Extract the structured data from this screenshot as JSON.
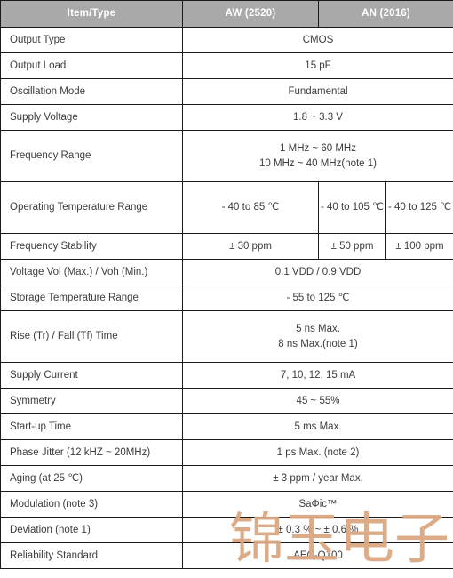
{
  "table": {
    "headers": [
      {
        "label": "Item/Type"
      },
      {
        "label": "AW (2520)"
      },
      {
        "label": "AN (2016)"
      }
    ],
    "rows": [
      {
        "name": "output-type",
        "label": "Output Type",
        "span": "full",
        "value": "CMOS"
      },
      {
        "name": "output-load",
        "label": "Output Load",
        "span": "full",
        "value": "15 pF"
      },
      {
        "name": "oscillation-mode",
        "label": "Oscillation Mode",
        "span": "full",
        "value": "Fundamental"
      },
      {
        "name": "supply-voltage",
        "label": "Supply Voltage",
        "span": "full",
        "value": "1.8 ~ 3.3 V"
      },
      {
        "name": "frequency-range",
        "label": "Frequency Range",
        "span": "full",
        "tall": true,
        "line1": "1 MHz ~ 60 MHz",
        "line2": "10 MHz ~ 40 MHz(note 1)"
      },
      {
        "name": "operating-temperature-range",
        "label": "Operating Temperature Range",
        "span": "split",
        "tall": true,
        "aw": "- 40 to 85 ℃",
        "an1": "- 40 to 105 ℃",
        "an2": "- 40 to 125 ℃"
      },
      {
        "name": "frequency-stability",
        "label": "Frequency Stability",
        "span": "split",
        "aw": "± 30 ppm",
        "an1": "± 50 ppm",
        "an2": "± 100 ppm"
      },
      {
        "name": "voltage-vol-voh",
        "label": "Voltage Vol (Max.) / Voh (Min.)",
        "span": "full",
        "value": "0.1 VDD / 0.9 VDD"
      },
      {
        "name": "storage-temperature-range",
        "label": "Storage Temperature Range",
        "span": "full",
        "value": "- 55 to 125 ℃"
      },
      {
        "name": "rise-fall-time",
        "label": "Rise (Tr) / Fall (Tf) Time",
        "span": "full",
        "tall": true,
        "line1": "5 ns Max.",
        "line2": "8 ns Max.(note 1)"
      },
      {
        "name": "supply-current",
        "label": "Supply Current",
        "span": "full",
        "value": "7, 10, 12, 15 mA"
      },
      {
        "name": "symmetry",
        "label": "Symmetry",
        "span": "full",
        "value": "45 ~ 55%"
      },
      {
        "name": "start-up-time",
        "label": "Start-up Time",
        "span": "full",
        "value": "5 ms Max."
      },
      {
        "name": "phase-jitter",
        "label": "Phase Jitter (12 kHZ ~ 20MHz)",
        "span": "full",
        "value": "1 ps Max. (note 2)"
      },
      {
        "name": "aging",
        "label": "Aging (at 25 ℃)",
        "span": "full",
        "value": "± 3 ppm / year Max."
      },
      {
        "name": "modulation",
        "label": "Modulation (note 3)",
        "span": "full",
        "value": "SaΦic™"
      },
      {
        "name": "deviation",
        "label": "Deviation (note 1)",
        "span": "full",
        "value": "± 0.3 % ~ ± 0.6 %"
      },
      {
        "name": "reliability-standard",
        "label": "Reliability Standard",
        "span": "full",
        "value": "AEC-Q100"
      }
    ]
  },
  "watermark": {
    "chars": [
      "锦",
      "玉",
      "电",
      "子"
    ],
    "color": "#dba883"
  },
  "colors": {
    "header_bg": "#a9a9a9",
    "header_text": "#ffffff",
    "border": "#1a1a1a",
    "body_text": "#3c3c3c",
    "page_bg": "#ffffff"
  }
}
